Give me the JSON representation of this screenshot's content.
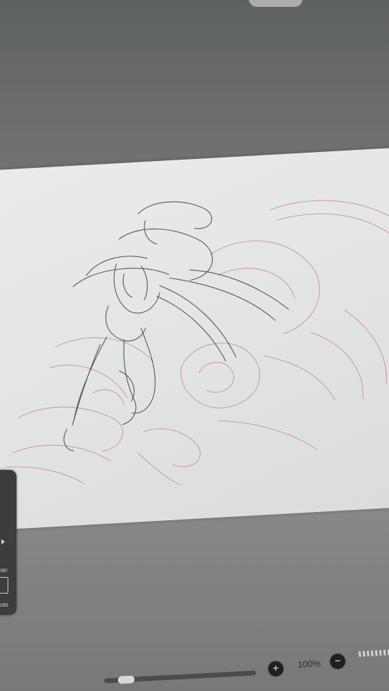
{
  "app": {
    "zoom_label": "100%",
    "zoom_in_symbol": "+",
    "zoom_out_symbol": "−"
  },
  "side_panel": {
    "paper_label": "per",
    "canvas_label": "vas"
  },
  "colors": {
    "ink_dark": "#3d3a40",
    "ink_red": "#c98a8e",
    "paper": "#e8eae9",
    "toolbar_dark": "#3c3d3f"
  },
  "icons": {
    "zoom_in": "plus-icon",
    "zoom_out": "minus-icon",
    "expand": "chevron-right-icon"
  }
}
